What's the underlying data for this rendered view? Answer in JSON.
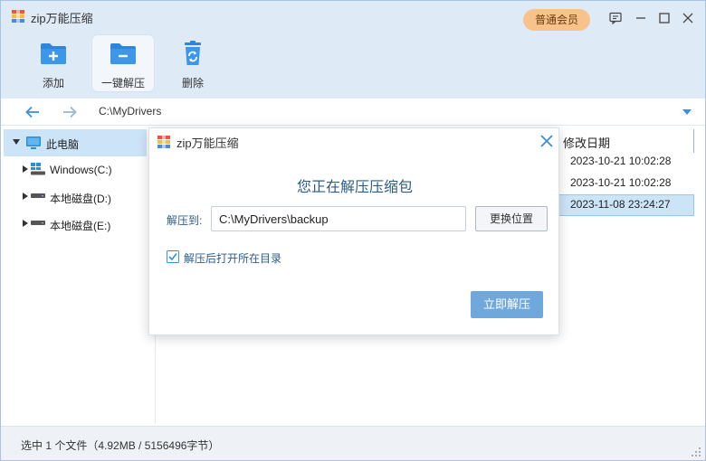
{
  "app": {
    "title": "zip万能压缩",
    "vip_label": "普通会员"
  },
  "toolbar": {
    "items": [
      {
        "label": "添加",
        "icon": "folder-plus-icon"
      },
      {
        "label": "一键解压",
        "icon": "folder-extract-icon"
      },
      {
        "label": "删除",
        "icon": "recycle-bin-icon"
      }
    ]
  },
  "address": {
    "path": "C:\\MyDrivers"
  },
  "tree": {
    "items": [
      {
        "label": "此电脑",
        "icon": "computer-icon",
        "expanded": true,
        "selected": true
      },
      {
        "label": "Windows(C:)",
        "icon": "windows-drive-icon"
      },
      {
        "label": "本地磁盘(D:)",
        "icon": "drive-icon"
      },
      {
        "label": "本地磁盘(E:)",
        "icon": "drive-icon"
      }
    ]
  },
  "list": {
    "column_header": "修改日期",
    "rows": [
      {
        "date": "2023-10-21 10:02:28"
      },
      {
        "date": "2023-10-21 10:02:28"
      },
      {
        "date": "2023-11-08 23:24:27",
        "selected": true
      }
    ]
  },
  "dialog": {
    "title": "zip万能压缩",
    "heading": "您正在解压压缩包",
    "target_label": "解压到:",
    "target_value": "C:\\MyDrivers\\backup",
    "change_button": "更换位置",
    "open_after_label": "解压后打开所在目录",
    "open_after_checked": true,
    "extract_button": "立即解压"
  },
  "status": {
    "text": "选中 1 个文件（4.92MB / 5156496字节）"
  },
  "colors": {
    "accent": "#6fa8dc",
    "vip": "#f8c38a",
    "selection": "#cce4f7",
    "heading": "#2d5c88"
  }
}
